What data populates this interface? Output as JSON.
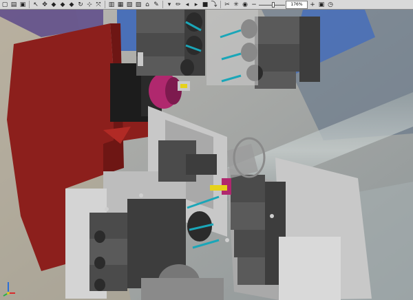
{
  "toolbar": {
    "buttons": [
      {
        "name": "new-doc-icon",
        "glyph": "▢"
      },
      {
        "name": "open-folder-icon",
        "glyph": "▤"
      },
      {
        "name": "save-icon",
        "glyph": "▣"
      },
      {
        "name": "select-arrow-icon",
        "glyph": "↖"
      },
      {
        "name": "pan-icon",
        "glyph": "✥"
      },
      {
        "name": "part-blue-icon",
        "glyph": "◆"
      },
      {
        "name": "part-purple-icon",
        "glyph": "◆"
      },
      {
        "name": "part-red-icon",
        "glyph": "◆"
      },
      {
        "name": "rotate-icon",
        "glyph": "↻"
      },
      {
        "name": "measure-icon",
        "glyph": "⊹"
      },
      {
        "name": "axis-icon",
        "glyph": "⤧"
      },
      {
        "name": "view-front-icon",
        "glyph": "▥"
      },
      {
        "name": "view-top-icon",
        "glyph": "▦"
      },
      {
        "name": "view-side-icon",
        "glyph": "▧"
      },
      {
        "name": "view-iso-icon",
        "glyph": "▨"
      },
      {
        "name": "home-view-icon",
        "glyph": "⌂"
      },
      {
        "name": "color-tools-icon",
        "glyph": "✎"
      },
      {
        "name": "dropdown-icon",
        "glyph": "▾"
      },
      {
        "name": "pencil-icon",
        "glyph": "✏"
      },
      {
        "name": "step-back-icon",
        "glyph": "◂"
      },
      {
        "name": "play-icon",
        "glyph": "▸"
      },
      {
        "name": "stop-icon",
        "glyph": "■"
      },
      {
        "name": "link-icon",
        "glyph": "⤵"
      },
      {
        "name": "section-icon",
        "glyph": "✂"
      },
      {
        "name": "light-icon",
        "glyph": "✳"
      },
      {
        "name": "camera-icon",
        "glyph": "◉"
      },
      {
        "name": "zoom-out-icon",
        "glyph": "−"
      }
    ],
    "zoom_value": "176%",
    "zoom_level": 0.55,
    "trailing_buttons": [
      {
        "name": "zoom-in-icon",
        "glyph": "+"
      },
      {
        "name": "fit-view-icon",
        "glyph": "▣"
      },
      {
        "name": "clock-icon",
        "glyph": "◷"
      }
    ]
  },
  "colors": {
    "toolbar_bg": "#d9d9d9",
    "machine_red": "#8c1f1c",
    "bed_blue": "#4a70b8",
    "spindle_magenta": "#b0286e",
    "tool_cyan": "#1aa6b8",
    "insert_yellow": "#e6d21a",
    "block_dark": "#3d3d3d",
    "block_mid": "#5a5a5a",
    "plate_light": "#c8c8c8"
  }
}
